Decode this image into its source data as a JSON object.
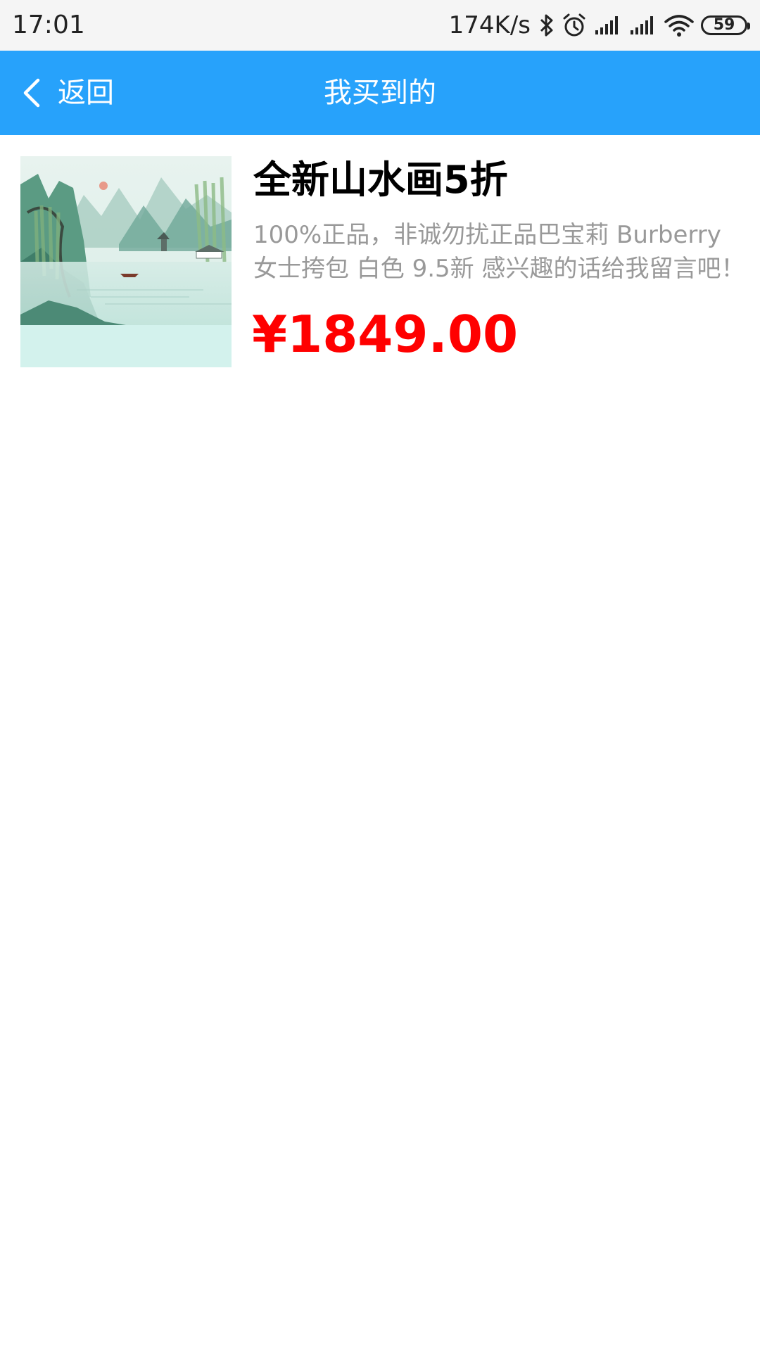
{
  "status_bar": {
    "time": "17:01",
    "net_speed": "174K/s",
    "battery": "59",
    "icons": [
      "bluetooth-icon",
      "alarm-icon",
      "signal-icon",
      "signal-icon",
      "wifi-icon",
      "battery-icon"
    ]
  },
  "app_bar": {
    "back_label": "返回",
    "title": "我买到的",
    "background": "#27a2fb"
  },
  "items": [
    {
      "title": "全新山水画5折",
      "description": "100%正品，非诚勿扰正品巴宝莉 Burberry 女士挎包 白色 9.5新 感兴趣的话给我留言吧！",
      "price": "¥1849.00",
      "price_color": "#ff0000",
      "image": "landscape-painting"
    }
  ]
}
